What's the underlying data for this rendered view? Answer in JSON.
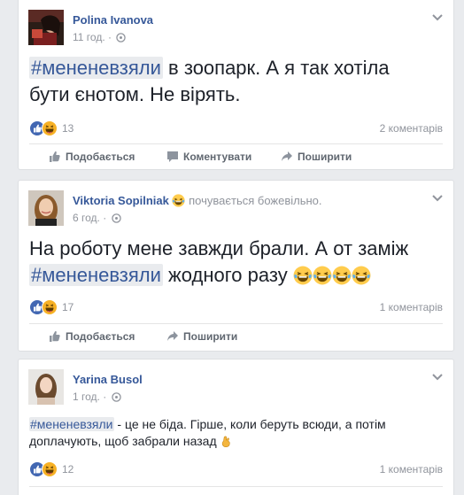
{
  "posts": [
    {
      "author": "Polina Ivanova",
      "feeling": "",
      "time": "11 год. · ",
      "hashtag": "#мененевзяли",
      "text_line1_rest": " в зоопарк. А я так хотіла",
      "text_line2": "бути єнотом. Не вірять.",
      "reaction_count": "13",
      "comments": "2 коментарів",
      "actions": [
        "Подобається",
        "Коментувати",
        "Поширити"
      ]
    },
    {
      "author": "Viktoria Sopilniak",
      "feeling": "почувається божевільно.",
      "time": "6 год. · ",
      "text_line1": "На роботу мене завжди брали. А от заміж",
      "hashtag": "#мененевзяли",
      "text_line2_rest": " жодного разу",
      "reaction_count": "17",
      "comments": "1 коментарів",
      "actions": [
        "Подобається",
        "Поширити"
      ]
    },
    {
      "author": "Yarina Busol",
      "feeling": "",
      "time": "1 год. · ",
      "hashtag": "#мененевзяли",
      "text_line1_rest": " - це не біда. Гірше, коли беруть всюди, а потім",
      "text_line2": "доплачують, щоб забрали назад",
      "reaction_count": "12",
      "comments": "1 коментарів"
    }
  ],
  "icons": {
    "like": "like-reaction-icon",
    "haha": "haha-reaction-icon",
    "globe": "globe-icon",
    "chevron": "chevron-down-icon",
    "thumb": "thumbs-up-icon",
    "comment": "comment-icon",
    "share": "share-icon",
    "emoji_laugh": "laughing-crying-emoji",
    "emoji_hand": "finger-crossed-emoji"
  },
  "colors": {
    "link": "#365899",
    "like_blue": "#4267b2",
    "haha_yellow": "#f7b125",
    "background": "#e9ebee"
  }
}
